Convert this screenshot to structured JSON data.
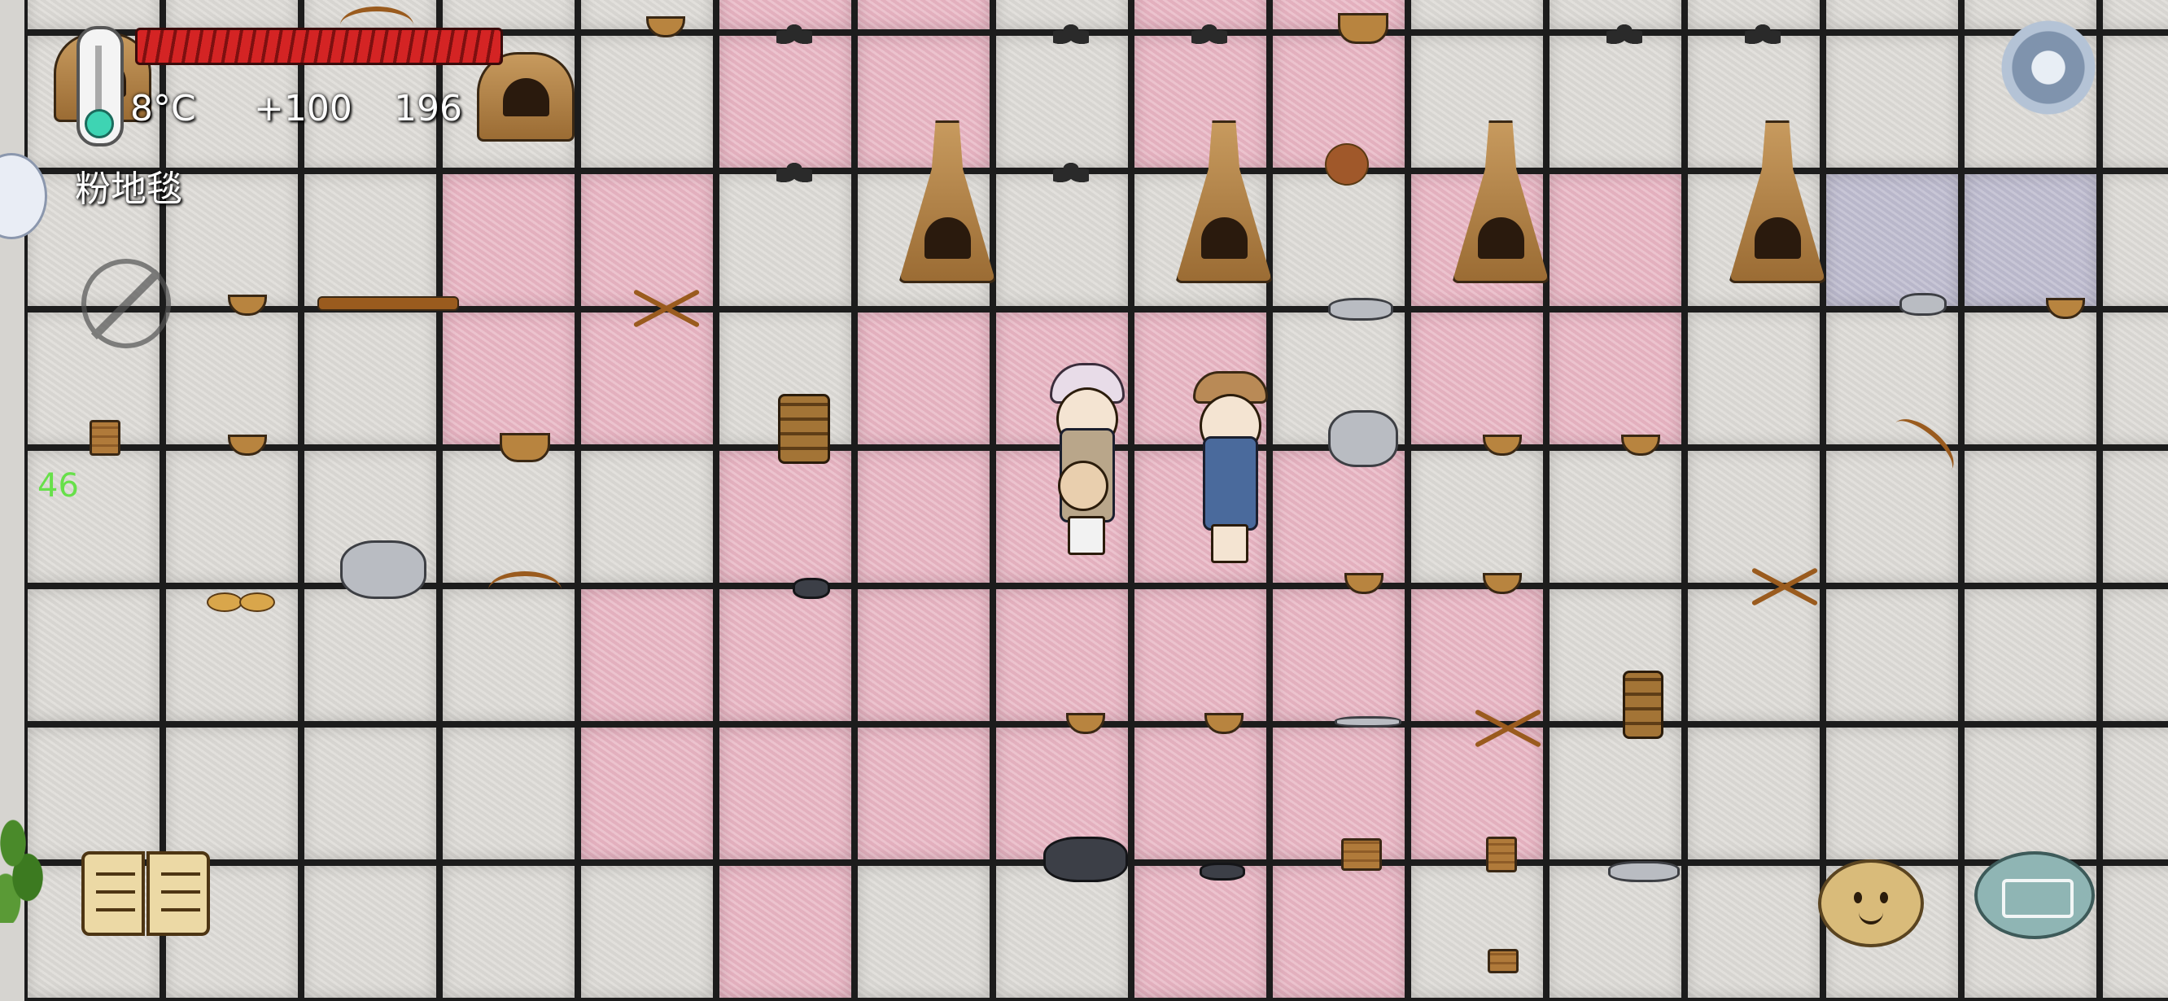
{
  "hud": {
    "temperature": "8°C",
    "score_delta": "+100",
    "count": "196",
    "location_label": "粉地毯",
    "fps": "46",
    "health_fraction": 1.0
  },
  "icons": {
    "thermometer": "thermometer-icon",
    "settings": "gear-icon",
    "no_food": "no-food-icon",
    "book": "book-icon",
    "emote": "emote-icon",
    "keyboard": "keyboard-icon"
  },
  "colors": {
    "health": "#d42424",
    "floor_pink": "#e8b8c5",
    "floor_grey": "#dcdad6",
    "fps_text": "#67e04a"
  }
}
